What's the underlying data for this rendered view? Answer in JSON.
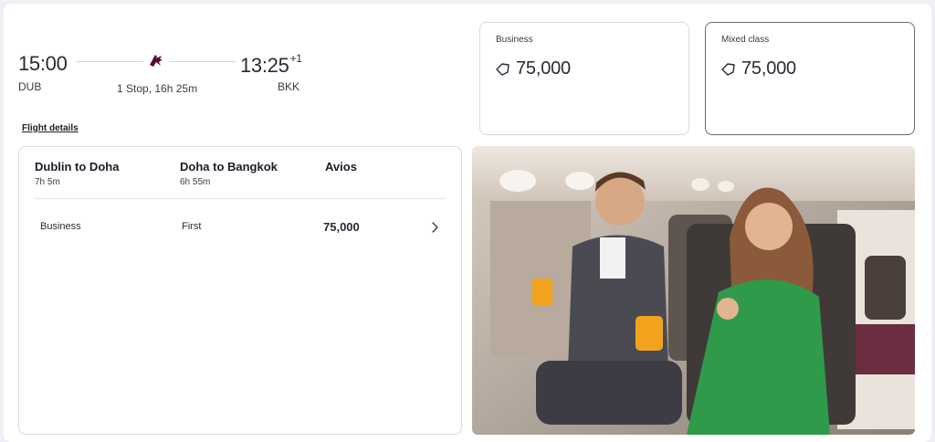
{
  "itinerary": {
    "depart_time": "15:00",
    "depart_code": "DUB",
    "arrive_time": "13:25",
    "arrive_day_offset": "+1",
    "arrive_code": "BKK",
    "stops_duration": "1 Stop, 16h 25m",
    "flight_details_link": "Flight details",
    "airline_logo_icon": "airline-oryx-logo-icon"
  },
  "fares": [
    {
      "label": "Business",
      "amount": "75,000",
      "icon": "avios-icon",
      "selected": false
    },
    {
      "label": "Mixed class",
      "amount": "75,000",
      "icon": "avios-icon",
      "selected": true
    }
  ],
  "segments": {
    "headers": [
      "Dublin to Doha",
      "Doha to Bangkok",
      "Avios"
    ],
    "durations": [
      "7h 5m",
      "6h 55m"
    ],
    "rows": [
      {
        "cabin_1": "Business",
        "cabin_2": "First",
        "avios": "75,000"
      }
    ]
  },
  "colors": {
    "accent": "#5c0632",
    "background": "#eef0f6",
    "border": "#d9dae2"
  }
}
